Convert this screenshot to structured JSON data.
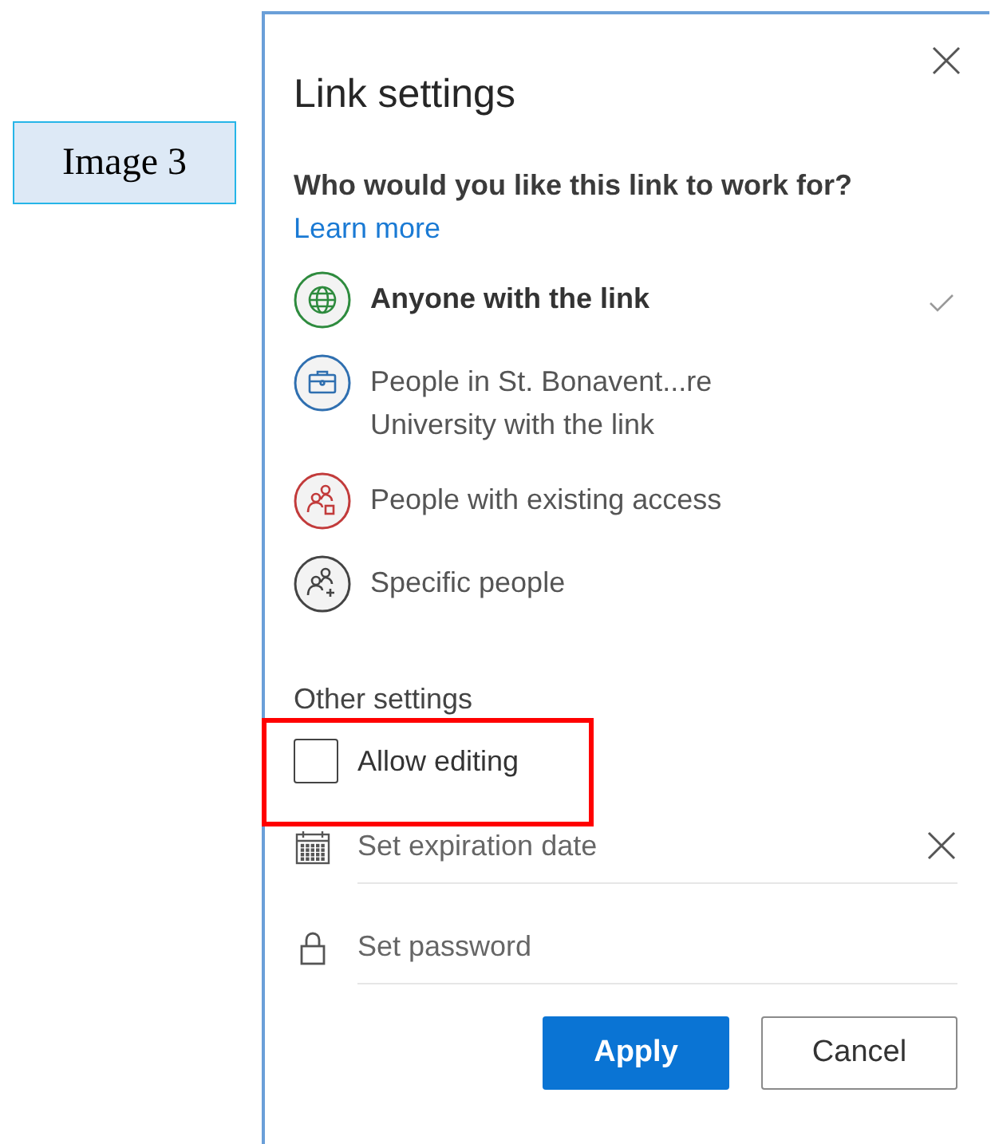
{
  "label": "Image 3",
  "dialog": {
    "title": "Link settings",
    "question": "Who would you like this link to work for?",
    "learn_more": "Learn more",
    "options": [
      {
        "kind": "anyone",
        "lines": [
          "Anyone with the link"
        ],
        "selected": true,
        "color": "#2e8b3e"
      },
      {
        "kind": "organization",
        "lines": [
          "People in St. Bonavent...re",
          "University with the link"
        ],
        "selected": false,
        "color": "#2f6fb0"
      },
      {
        "kind": "existing",
        "lines": [
          "People with existing access"
        ],
        "selected": false,
        "color": "#c23b3b"
      },
      {
        "kind": "specific",
        "lines": [
          "Specific people"
        ],
        "selected": false,
        "color": "#444444"
      }
    ],
    "other_heading": "Other settings",
    "allow_editing": {
      "label": "Allow editing",
      "checked": false
    },
    "fields": [
      {
        "kind": "date",
        "placeholder": "Set expiration date",
        "clearable": true
      },
      {
        "kind": "password",
        "placeholder": "Set password",
        "clearable": false
      }
    ],
    "buttons": [
      {
        "label": "Apply",
        "kind": "primary"
      },
      {
        "label": "Cancel",
        "kind": "secondary"
      }
    ]
  }
}
